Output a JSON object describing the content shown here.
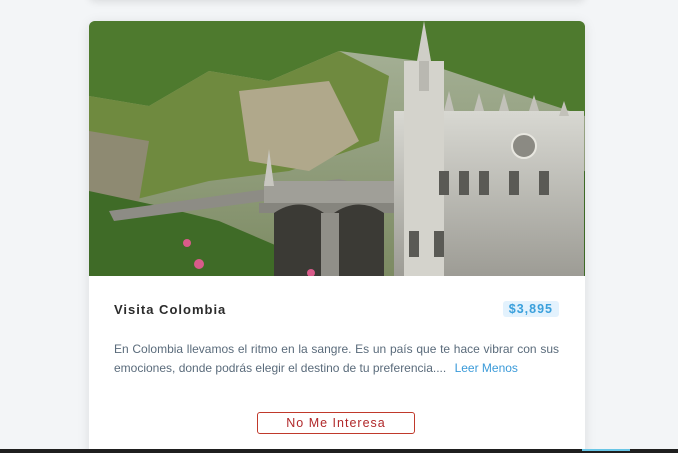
{
  "card": {
    "title": "Visita Colombia",
    "price": "$3,895",
    "description": "En Colombia llevamos el ritmo en la sangre. Es un país que te hace vibrar con sus emociones, donde podrás elegir el destino de tu preferencia....",
    "read_less_link": "Leer Menos",
    "dismiss_button": "No Me Interesa"
  },
  "colors": {
    "price_badge_bg": "#e3f2fd",
    "price_text": "#3aa0dc",
    "link": "#3a9ad9",
    "dismiss_border": "#c0392b"
  }
}
